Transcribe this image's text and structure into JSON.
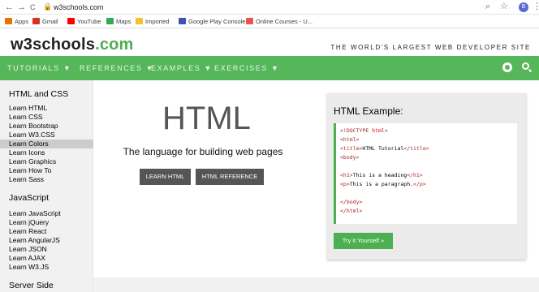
{
  "browser": {
    "back": "←",
    "forward": "→",
    "reload": "C",
    "url": "w3schools.com",
    "avatar": "B",
    "icons": [
      "back-arrow-icon",
      "forward-arrow-icon",
      "reload-icon",
      "lock-icon",
      "zoom-icon",
      "star-icon",
      "profile-avatar",
      "menu-dots-icon"
    ]
  },
  "bookmarks": [
    {
      "label": "Apps",
      "color": "#e37400"
    },
    {
      "label": "Gmail",
      "color": "#d93025"
    },
    {
      "label": "YouTube",
      "color": "#ff0000"
    },
    {
      "label": "Maps",
      "color": "#34a853"
    },
    {
      "label": "Imported",
      "color": "#f6c026"
    },
    {
      "label": "Google Play Console",
      "color": "#3f51b5"
    },
    {
      "label": "Online Courses - U...",
      "color": "#ec5252"
    }
  ],
  "site": {
    "logo_main": "w3schools",
    "logo_suffix": ".com",
    "slogan": "THE WORLD'S LARGEST WEB DEVELOPER SITE",
    "accent": "#4CAF50"
  },
  "topnav": [
    "TUTORIALS ▼",
    "REFERENCES ▼",
    "EXAMPLES ▼",
    "EXERCISES ▼"
  ],
  "sidebar": {
    "heading1": "HTML and CSS",
    "group1": [
      "Learn HTML",
      "Learn CSS",
      "Learn Bootstrap",
      "Learn W3.CSS",
      "Learn Colors",
      "Learn Icons",
      "Learn Graphics",
      "Learn How To",
      "Learn Sass"
    ],
    "heading2": "JavaScript",
    "group2": [
      "Learn JavaScript",
      "Learn jQuery",
      "Learn React",
      "Learn AngularJS",
      "Learn JSON",
      "Learn AJAX",
      "Learn W3.JS"
    ],
    "heading3": "Server Side"
  },
  "hero": {
    "title": "HTML",
    "subtitle": "The language for building web pages",
    "btn_learn": "LEARN HTML",
    "btn_ref": "HTML REFERENCE"
  },
  "example": {
    "title": "HTML Example:",
    "try_label": "Try it Yourself »"
  }
}
